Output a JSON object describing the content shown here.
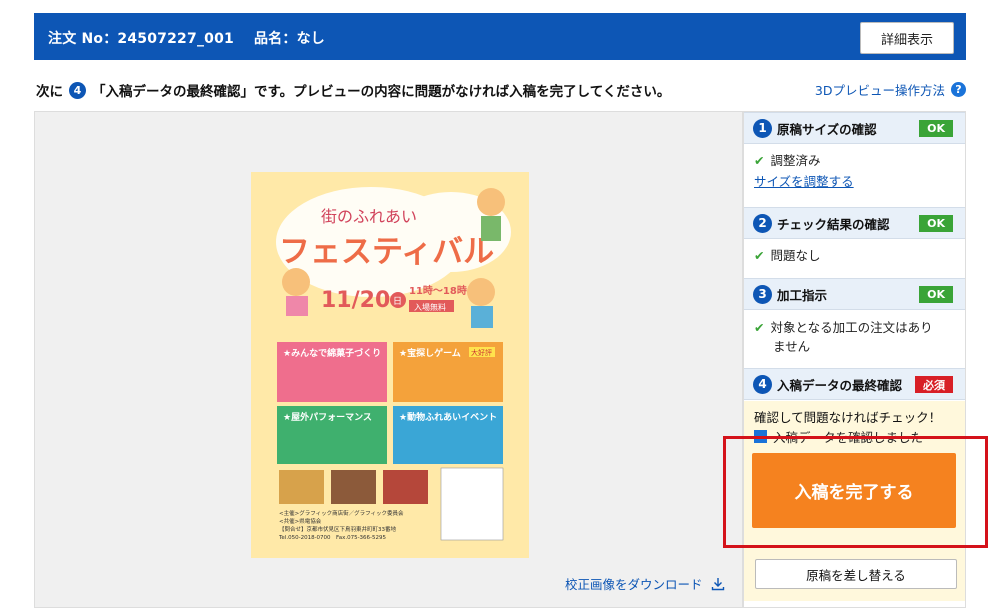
{
  "header": {
    "order_label": "注文 No：24507227_001",
    "product_label": "品名：なし",
    "detail_button": "詳細表示"
  },
  "instruction": {
    "prefix": "次に",
    "step_num": "4",
    "text": "「入稿データの最終確認」です。プレビューの内容に問題がなければ入稿を完了してください。"
  },
  "help_link": "3Dプレビュー操作方法",
  "help_icon": "?",
  "download_link": "校正画像をダウンロード",
  "flyer": {
    "title_small": "街のふれあい",
    "title_big": "フェスティバル",
    "date": "11/20",
    "date_day": "日",
    "time": "11時〜18時",
    "entry": "入場無料",
    "box1": "★みんなで綿菓子づくり",
    "box2": "★宝探しゲーム",
    "box2_tag": "大好評",
    "box3": "★屋外パフォーマンス",
    "box4": "★動物ふれあいイベント",
    "org1": "<主催>グラフィック商店街／グラフィック委員会",
    "org2": "<共催>県電協会",
    "org3": "【問合せ】京都市伏見区下鳥羽東井町町33番地",
    "org4": "Tel.050-2018-0700　Fax.075-366-5295"
  },
  "steps": [
    {
      "num": "1",
      "title": "原稿サイズの確認",
      "badge": "OK",
      "status": "調整済み",
      "link": "サイズを調整する"
    },
    {
      "num": "2",
      "title": "チェック結果の確認",
      "badge": "OK",
      "status": "問題なし"
    },
    {
      "num": "3",
      "title": "加工指示",
      "badge": "OK",
      "status_line1": "対象となる加工の注文はあり",
      "status_line2": "ません"
    },
    {
      "num": "4",
      "title": "入稿データの最終確認",
      "badge": "必須",
      "confirm": "確認して問題なければチェック！",
      "checkbox_label": "入稿データを確認しました"
    }
  ],
  "complete_button": "入稿を完了する",
  "replace_button": "原稿を差し替える",
  "colors": {
    "brand_blue": "#0d56b5",
    "ok_green": "#3aa437",
    "required_red": "#d81f26",
    "cta_orange": "#f5821f"
  }
}
